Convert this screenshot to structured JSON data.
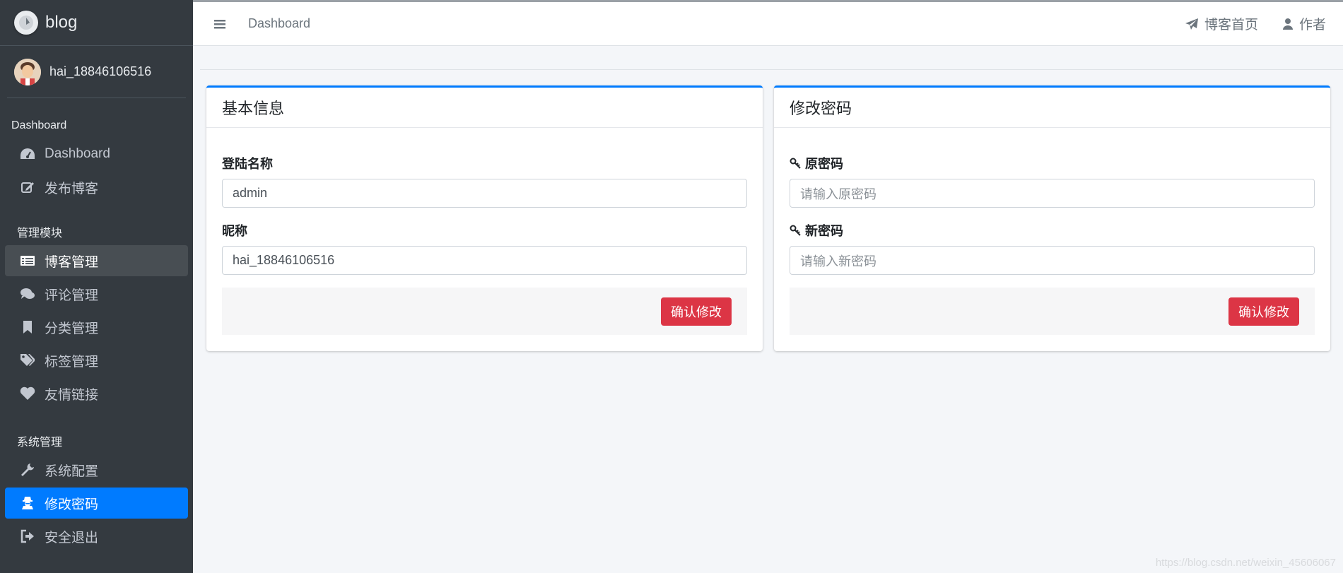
{
  "brand": {
    "name": "blog",
    "icon": "blog-logo-icon"
  },
  "user": {
    "name": "hai_18846106516",
    "icon": "avatar"
  },
  "sidebar": {
    "sections": [
      {
        "header": "Dashboard",
        "items": [
          {
            "label": "Dashboard",
            "icon": "tachometer-icon"
          },
          {
            "label": "发布博客",
            "icon": "edit-icon"
          }
        ]
      },
      {
        "header": "管理模块",
        "items": [
          {
            "label": "博客管理",
            "icon": "list-icon",
            "state": "hover"
          },
          {
            "label": "评论管理",
            "icon": "comments-icon"
          },
          {
            "label": "分类管理",
            "icon": "bookmark-icon"
          },
          {
            "label": "标签管理",
            "icon": "tags-icon"
          },
          {
            "label": "友情链接",
            "icon": "heart-icon"
          }
        ]
      },
      {
        "header": "系统管理",
        "items": [
          {
            "label": "系统配置",
            "icon": "wrench-icon"
          },
          {
            "label": "修改密码",
            "icon": "user-secret-icon",
            "state": "active"
          },
          {
            "label": "安全退出",
            "icon": "sign-out-icon"
          }
        ]
      }
    ]
  },
  "topbar": {
    "breadcrumb": "Dashboard",
    "links": [
      {
        "label": "博客首页",
        "icon": "paper-plane-icon"
      },
      {
        "label": "作者",
        "icon": "user-icon"
      }
    ]
  },
  "basic_info": {
    "title": "基本信息",
    "login_label": "登陆名称",
    "login_value": "admin",
    "nickname_label": "昵称",
    "nickname_value": "hai_18846106516",
    "submit_label": "确认修改"
  },
  "change_password": {
    "title": "修改密码",
    "old_label": "原密码",
    "old_placeholder": "请输入原密码",
    "new_label": "新密码",
    "new_placeholder": "请输入新密码",
    "submit_label": "确认修改"
  },
  "watermark": "https://blog.csdn.net/weixin_45606067",
  "colors": {
    "sidebar": "#343a40",
    "accent": "#007bff",
    "danger": "#dc3545",
    "background": "#f4f6f9"
  }
}
